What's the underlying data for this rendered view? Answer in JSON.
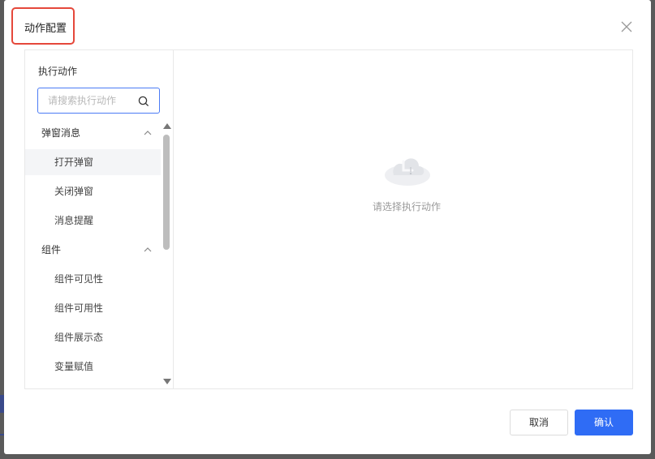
{
  "dialog": {
    "title": "动作配置",
    "close_icon": "close-icon"
  },
  "left_panel": {
    "label": "执行动作",
    "search_placeholder": "请搜索执行动作",
    "groups": [
      {
        "label": "弹窗消息",
        "items": [
          "打开弹窗",
          "关闭弹窗",
          "消息提醒"
        ]
      },
      {
        "label": "组件",
        "items": [
          "组件可见性",
          "组件可用性",
          "组件展示态",
          "变量赋值"
        ]
      }
    ],
    "active_item": "打开弹窗"
  },
  "right_panel": {
    "empty_text": "请选择执行动作",
    "empty_icon": "empty-cloud-icon"
  },
  "footer": {
    "cancel_label": "取消",
    "ok_label": "确认"
  },
  "colors": {
    "primary": "#2f6cf5",
    "highlight_border": "#e5483b"
  }
}
